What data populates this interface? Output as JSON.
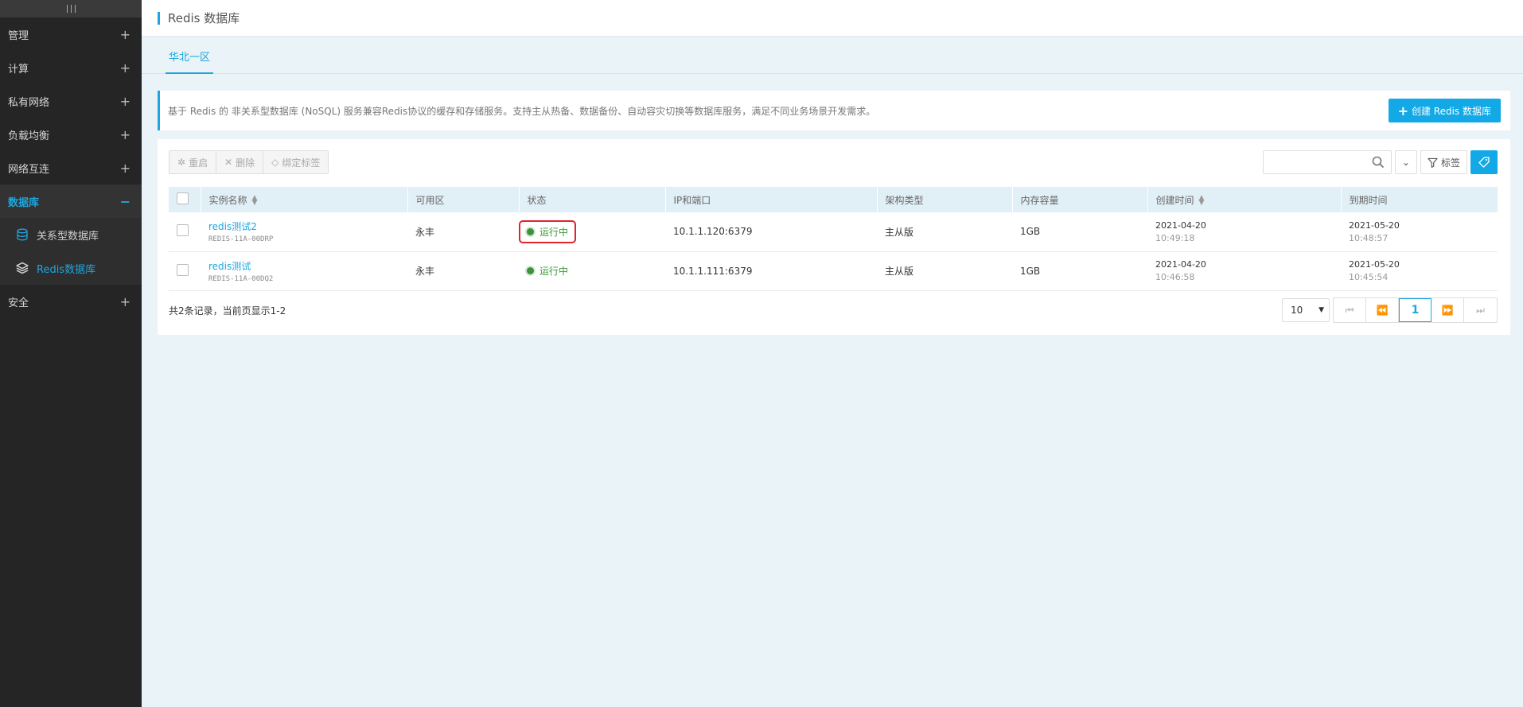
{
  "sidebar": {
    "items": [
      {
        "label": "管理"
      },
      {
        "label": "计算"
      },
      {
        "label": "私有网络"
      },
      {
        "label": "负载均衡"
      },
      {
        "label": "网络互连"
      },
      {
        "label": "数据库",
        "expanded": true
      },
      {
        "label": "安全"
      }
    ],
    "database_sub": [
      {
        "label": "关系型数据库",
        "icon": "database-icon"
      },
      {
        "label": "Redis数据库",
        "icon": "layers-icon",
        "active": true
      }
    ]
  },
  "header": {
    "title": "Redis 数据库"
  },
  "tabs": [
    {
      "label": "华北一区",
      "active": true
    }
  ],
  "info": {
    "description": "基于 Redis 的 非关系型数据库 (NoSQL) 服务兼容Redis协议的缓存和存储服务。支持主从热备、数据备份、自动容灾切换等数据库服务，满足不同业务场景开发需求。",
    "create_button": "创建 Redis 数据库"
  },
  "toolbar": {
    "restart": "重启",
    "delete": "删除",
    "bind_tag": "绑定标签",
    "search_placeholder": "",
    "tag_filter": "标签"
  },
  "table": {
    "columns": [
      "实例名称",
      "可用区",
      "状态",
      "IP和端口",
      "架构类型",
      "内存容量",
      "创建时间",
      "到期时间"
    ],
    "rows": [
      {
        "name": "redis测试2",
        "id": "REDIS-11A-00DRP",
        "zone": "永丰",
        "status": "运行中",
        "ip_port": "10.1.1.120:6379",
        "arch": "主从版",
        "memory": "1GB",
        "created_date": "2021-04-20",
        "created_time": "10:49:18",
        "expire_date": "2021-05-20",
        "expire_time": "10:48:57"
      },
      {
        "name": "redis测试",
        "id": "REDIS-11A-00DQ2",
        "zone": "永丰",
        "status": "运行中",
        "ip_port": "10.1.1.111:6379",
        "arch": "主从版",
        "memory": "1GB",
        "created_date": "2021-04-20",
        "created_time": "10:46:58",
        "expire_date": "2021-05-20",
        "expire_time": "10:45:54"
      }
    ]
  },
  "footer": {
    "count_text": "共2条记录，当前页显示1-2",
    "page_size": "10",
    "current_page": "1"
  },
  "colors": {
    "accent": "#1da6df",
    "running": "#3a9a3a",
    "highlight_box": "#e0242a"
  }
}
